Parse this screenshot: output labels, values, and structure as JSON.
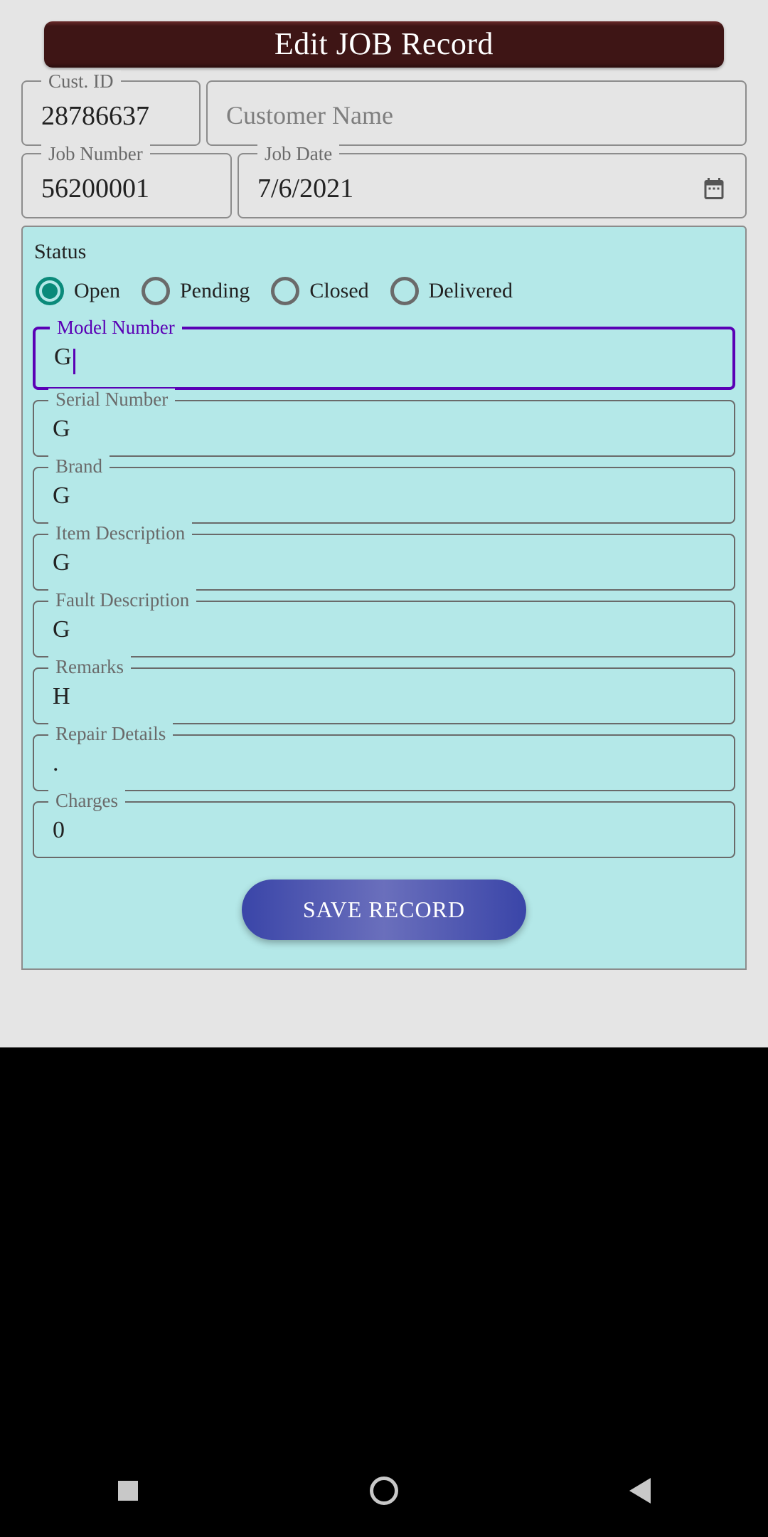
{
  "header": {
    "title": "Edit JOB Record"
  },
  "top": {
    "custid_label": "Cust. ID",
    "custid_value": "28786637",
    "custname_label": "",
    "custname_placeholder": "Customer Name",
    "custname_value": "",
    "jobnumber_label": "Job Number",
    "jobnumber_value": "56200001",
    "jobdate_label": "Job Date",
    "jobdate_value": "7/6/2021"
  },
  "status": {
    "label": "Status",
    "options": [
      "Open",
      "Pending",
      "Closed",
      "Delivered"
    ],
    "selected": "Open"
  },
  "fields": {
    "model_label": "Model Number",
    "model_value": "G",
    "serial_label": "Serial Number",
    "serial_value": "G",
    "brand_label": "Brand",
    "brand_value": "G",
    "itemdesc_label": "Item Description",
    "itemdesc_value": "G",
    "faultdesc_label": "Fault Description",
    "faultdesc_value": "G",
    "remarks_label": "Remarks",
    "remarks_value": "H",
    "repair_label": "Repair Details",
    "repair_value": ".",
    "charges_label": "Charges",
    "charges_value": "0"
  },
  "save_button": "SAVE RECORD"
}
